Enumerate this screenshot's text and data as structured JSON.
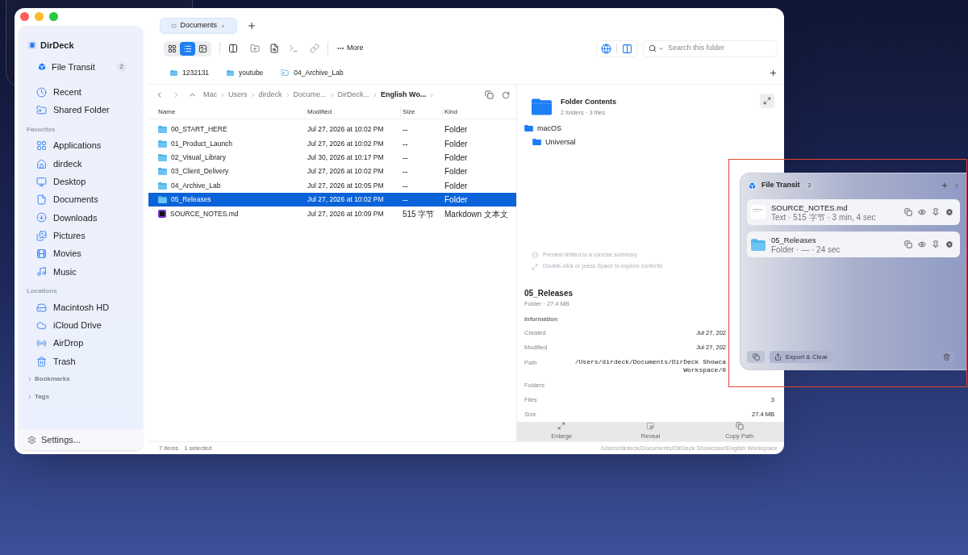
{
  "sidebar": {
    "app_name": "DirDeck",
    "transit": {
      "label": "File Transit",
      "count": "2"
    },
    "top_items": [
      {
        "label": "Recent"
      },
      {
        "label": "Shared Folder"
      }
    ],
    "sections": [
      {
        "title": "Favorites",
        "items": [
          {
            "label": "Applications"
          },
          {
            "label": "dirdeck"
          },
          {
            "label": "Desktop"
          },
          {
            "label": "Documents"
          },
          {
            "label": "Downloads"
          },
          {
            "label": "Pictures"
          },
          {
            "label": "Movies"
          },
          {
            "label": "Music"
          }
        ]
      },
      {
        "title": "Locations",
        "items": [
          {
            "label": "Macintosh HD"
          },
          {
            "label": "iCloud Drive"
          },
          {
            "label": "AirDrop"
          },
          {
            "label": "Trash"
          }
        ]
      }
    ],
    "collapsibles": [
      {
        "label": "Bookmarks",
        "expanded": false
      },
      {
        "label": "Tags",
        "expanded": false
      }
    ],
    "settings": "Settings..."
  },
  "tabs": [
    {
      "label": "Documents",
      "selected": true
    }
  ],
  "toolbar": {
    "view_modes": [
      {
        "kind": "grid",
        "selected": false
      },
      {
        "kind": "list",
        "selected": true
      },
      {
        "kind": "gallery",
        "selected": false
      }
    ],
    "more": "More",
    "search": {
      "placeholder": "Search this folder"
    }
  },
  "favorites_bar": [
    {
      "label": "1232131",
      "kind": "folder"
    },
    {
      "label": "youtube",
      "kind": "folder"
    },
    {
      "label": "04_Archive_Lab",
      "kind": "alias"
    }
  ],
  "breadcrumb": [
    "Mac",
    "Users",
    "dirdeck",
    "Docume...",
    "DirDeck...",
    "English Wo..."
  ],
  "table": {
    "columns": [
      "Name",
      "Modified",
      "Size",
      "Kind"
    ],
    "rows": [
      {
        "name": "00_START_HERE",
        "modified": "Jul 27, 2026 at 10:02 PM",
        "size": "--",
        "kind_label": "Folder",
        "kind": "folder",
        "selected": false
      },
      {
        "name": "01_Product_Launch",
        "modified": "Jul 27, 2026 at 10:02 PM",
        "size": "--",
        "kind_label": "Folder",
        "kind": "folder",
        "selected": false
      },
      {
        "name": "02_Visual_Library",
        "modified": "Jul 30, 2026 at 10:17 PM",
        "size": "--",
        "kind_label": "Folder",
        "kind": "folder",
        "selected": false
      },
      {
        "name": "03_Client_Delivery",
        "modified": "Jul 27, 2026 at 10:02 PM",
        "size": "--",
        "kind_label": "Folder",
        "kind": "folder",
        "selected": false
      },
      {
        "name": "04_Archive_Lab",
        "modified": "Jul 27, 2026 at 10:05 PM",
        "size": "--",
        "kind_label": "Folder",
        "kind": "folder",
        "selected": false
      },
      {
        "name": "05_Releases",
        "modified": "Jul 27, 2026 at 10:02 PM",
        "size": "--",
        "kind_label": "Folder",
        "kind": "folder",
        "selected": true
      },
      {
        "name": "SOURCE_NOTES.md",
        "modified": "Jul 27, 2026 at 10:09 PM",
        "size": "515 字节",
        "kind_label": "Markdown 文本文",
        "kind": "markdown",
        "selected": false
      }
    ]
  },
  "preview": {
    "title": "Folder Contents",
    "subtitle": "2 folders · 3 files",
    "tree": [
      {
        "name": "macOS",
        "children": [
          {
            "name": "Universal"
          }
        ]
      }
    ],
    "hints": [
      "Preview limited to a concise summary",
      "Double-click or press Space to explore contents"
    ],
    "name": "05_Releases",
    "meta": "Folder · 27.4 MB",
    "info_title": "Information",
    "info": [
      {
        "label": "Created",
        "values": [
          "Jul 27, 202"
        ]
      },
      {
        "label": "Modified",
        "values": [
          "Jul 27, 202"
        ]
      },
      {
        "label": "Path",
        "values": [
          "/Users/dirdeck/Documents/DirDeck Showca",
          "Workspace/0"
        ]
      },
      {
        "label": "Folders"
      },
      {
        "label": "Files",
        "values": [
          "3"
        ]
      },
      {
        "label": "Size",
        "values": [
          "27.4 MB"
        ]
      }
    ],
    "actions": [
      {
        "label": "Enlarge"
      },
      {
        "label": "Reveal"
      },
      {
        "label": "Copy Path"
      }
    ]
  },
  "status_bar": {
    "count": "7 items",
    "selection": "1 selected",
    "path": "/Users/dirdeck/Documents/DirDeck Showcase/English Workspace"
  },
  "transit_panel": {
    "title": "File Transit",
    "count": "2",
    "items": [
      {
        "name": "SOURCE_NOTES.md",
        "meta": "Text · 515 字节 · 3 min, 4 sec",
        "kind": "text"
      },
      {
        "name": "05_Releases",
        "meta": "Folder · — · 24 sec",
        "kind": "folder"
      }
    ],
    "export": "Export & Clear"
  }
}
